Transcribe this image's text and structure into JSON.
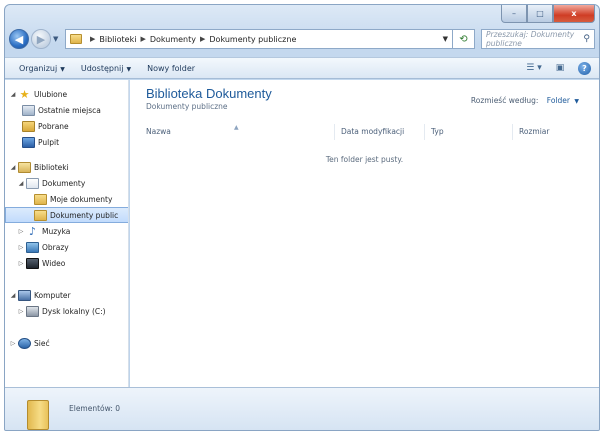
{
  "title_bar": {
    "minimize": "–",
    "maximize": "□",
    "close": "x"
  },
  "address": {
    "breadcrumbs": [
      "Biblioteki",
      "Dokumenty",
      "Dokumenty publiczne"
    ],
    "search_placeholder": "Przeszukaj: Dokumenty publiczne"
  },
  "toolbar": {
    "organize": "Organizuj",
    "share": "Udostępnij",
    "new_folder": "Nowy folder"
  },
  "sidebar": {
    "favorites": {
      "label": "Ulubione",
      "items": [
        "Ostatnie miejsca",
        "Pobrane",
        "Pulpit"
      ]
    },
    "libraries": {
      "label": "Biblioteki",
      "documents": "Dokumenty",
      "doc_children": [
        "Moje dokumenty",
        "Dokumenty public"
      ],
      "others": [
        "Muzyka",
        "Obrazy",
        "Wideo"
      ]
    },
    "computer": {
      "label": "Komputer",
      "items": [
        "Dysk lokalny (C:)"
      ]
    },
    "network": {
      "label": "Sieć"
    }
  },
  "main": {
    "title": "Biblioteka Dokumenty",
    "subtitle": "Dokumenty publiczne",
    "arrange_label": "Rozmieść według:",
    "arrange_value": "Folder",
    "columns": [
      "Nazwa",
      "Data modyfikacji",
      "Typ",
      "Rozmiar"
    ],
    "empty_message": "Ten folder jest pusty."
  },
  "details": {
    "count": "Elementów: 0"
  },
  "icons": {
    "back": "arrow-left",
    "forward": "arrow-right",
    "refresh": "refresh",
    "search": "magnifier",
    "views": "grid",
    "preview": "preview-pane",
    "help": "question"
  }
}
